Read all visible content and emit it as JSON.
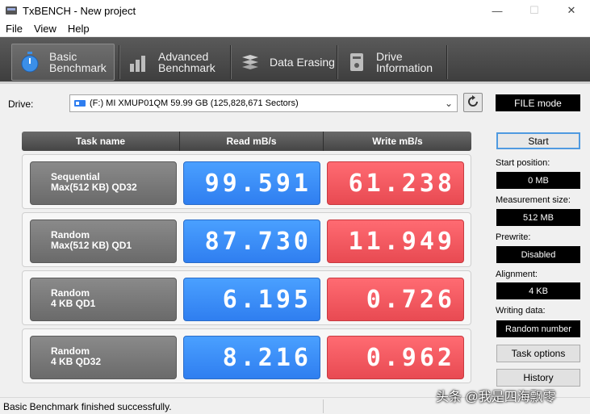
{
  "window": {
    "title": "TxBENCH - New project",
    "minimize": "—",
    "maximize": "☐",
    "close": "✕"
  },
  "menu": [
    "File",
    "View",
    "Help"
  ],
  "tabs": [
    {
      "line1": "Basic",
      "line2": "Benchmark",
      "icon": "stopwatch-icon"
    },
    {
      "line1": "Advanced",
      "line2": "Benchmark",
      "icon": "bar-chart-icon"
    },
    {
      "line1": "Data Erasing",
      "line2": "",
      "icon": "eraser-icon"
    },
    {
      "line1": "Drive",
      "line2": "Information",
      "icon": "drive-info-icon"
    }
  ],
  "drive": {
    "label": "Drive:",
    "value": "(F:) MI XMUP01QM  59.99 GB (125,828,671 Sectors)",
    "mode": "FILE mode"
  },
  "results": {
    "headers": [
      "Task name",
      "Read mB/s",
      "Write mB/s"
    ],
    "rows": [
      {
        "line1": "Sequential",
        "line2": "Max(512 KB) QD32",
        "read": "99.591",
        "write": "61.238"
      },
      {
        "line1": "Random",
        "line2": "Max(512 KB) QD1",
        "read": "87.730",
        "write": "11.949"
      },
      {
        "line1": "Random",
        "line2": "4 KB QD1",
        "read": "6.195",
        "write": "0.726"
      },
      {
        "line1": "Random",
        "line2": "4 KB QD32",
        "read": "8.216",
        "write": "0.962"
      }
    ]
  },
  "panel": {
    "start": "Start",
    "start_position_label": "Start position:",
    "start_position": "0 MB",
    "measurement_size_label": "Measurement size:",
    "measurement_size": "512 MB",
    "prewrite_label": "Prewrite:",
    "prewrite": "Disabled",
    "alignment_label": "Alignment:",
    "alignment": "4 KB",
    "writing_data_label": "Writing data:",
    "writing_data": "Random number",
    "task_options": "Task options",
    "history": "History"
  },
  "status": {
    "text": "Basic Benchmark finished successfully."
  },
  "watermark": "头条 @我是四海飘零"
}
